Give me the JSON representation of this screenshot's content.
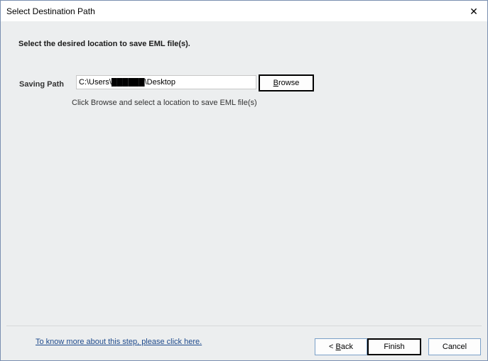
{
  "window": {
    "title": "Select Destination Path",
    "close_glyph": "✕"
  },
  "main": {
    "heading": "Select the desired location to save EML file(s).",
    "saving_path_label": "Saving Path",
    "saving_path_value": "C:\\Users\\██████\\Desktop",
    "browse_label_mnemonic": "B",
    "browse_label_rest": "rowse",
    "hint": "Click Browse and select a location to save EML file(s)"
  },
  "footer": {
    "help_link": "To know more about this step, please click here.",
    "back_prefix": "< ",
    "back_mnemonic": "B",
    "back_rest": "ack",
    "finish_label": "Finish",
    "cancel_label": "Cancel"
  },
  "colors": {
    "link": "#1e4a8c",
    "panel_bg": "#eceeef",
    "focus_border": "#000000",
    "button_border": "#7aa0c8"
  }
}
